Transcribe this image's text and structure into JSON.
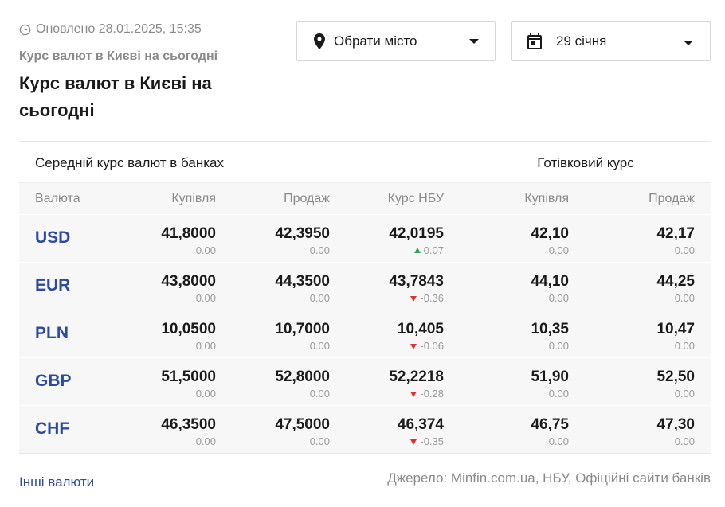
{
  "updated": {
    "text": "Оновлено 28.01.2025, 15:35"
  },
  "header": {
    "subtitle": "Курс валют в Києві на сьогодні",
    "title": "Курс валют в Києві на сьогодні"
  },
  "filters": {
    "city_label": "Обрати місто",
    "date_label": "29 січня"
  },
  "table": {
    "group_left": "Середній курс валют в банках",
    "group_right": "Готівковий курс",
    "columns": [
      "Валюта",
      "Купівля",
      "Продаж",
      "Курс НБУ",
      "Купівля",
      "Продаж"
    ],
    "rows": [
      {
        "code": "USD",
        "buy": "41,8000",
        "buy_chg": "0.00",
        "sell": "42,3950",
        "sell_chg": "0.00",
        "nbu": "42,0195",
        "nbu_chg": "0.07",
        "nbu_dir": "up",
        "cash_buy": "42,10",
        "cash_buy_chg": "0.00",
        "cash_sell": "42,17",
        "cash_sell_chg": "0.00"
      },
      {
        "code": "EUR",
        "buy": "43,8000",
        "buy_chg": "0.00",
        "sell": "44,3500",
        "sell_chg": "0.00",
        "nbu": "43,7843",
        "nbu_chg": "-0.36",
        "nbu_dir": "down",
        "cash_buy": "44,10",
        "cash_buy_chg": "0.00",
        "cash_sell": "44,25",
        "cash_sell_chg": "0.00"
      },
      {
        "code": "PLN",
        "buy": "10,0500",
        "buy_chg": "0.00",
        "sell": "10,7000",
        "sell_chg": "0.00",
        "nbu": "10,405",
        "nbu_chg": "-0.06",
        "nbu_dir": "down",
        "cash_buy": "10,35",
        "cash_buy_chg": "0.00",
        "cash_sell": "10,47",
        "cash_sell_chg": "0.00"
      },
      {
        "code": "GBP",
        "buy": "51,5000",
        "buy_chg": "0.00",
        "sell": "52,8000",
        "sell_chg": "0.00",
        "nbu": "52,2218",
        "nbu_chg": "-0.28",
        "nbu_dir": "down",
        "cash_buy": "51,90",
        "cash_buy_chg": "0.00",
        "cash_sell": "52,50",
        "cash_sell_chg": "0.00"
      },
      {
        "code": "CHF",
        "buy": "46,3500",
        "buy_chg": "0.00",
        "sell": "47,5000",
        "sell_chg": "0.00",
        "nbu": "46,374",
        "nbu_chg": "-0.35",
        "nbu_dir": "down",
        "cash_buy": "46,75",
        "cash_buy_chg": "0.00",
        "cash_sell": "47,30",
        "cash_sell_chg": "0.00"
      }
    ]
  },
  "footer": {
    "other_link": "Інші валюти",
    "source": "Джерело: Minfin.com.ua, НБУ, Офіційні сайти банків"
  },
  "colors": {
    "accent": "#2c4a9e",
    "up": "#2aa84a",
    "down": "#e03030",
    "muted": "#8a8a8a",
    "row_bg": "#f7f7f7"
  },
  "icons": {
    "updated": "clock-icon",
    "city": "map-pin-icon",
    "date": "calendar-icon",
    "dropdown": "caret-down-icon"
  }
}
